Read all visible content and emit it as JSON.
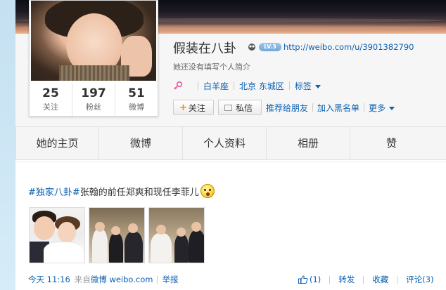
{
  "profile": {
    "name": "假装在八卦",
    "level_badge": "LV.3",
    "url": "http://weibo.com/u/3901382790",
    "bio": "她还没有填写个人简介",
    "meta": {
      "zodiac": "白羊座",
      "location": "北京 东城区",
      "tags_label": "标签"
    },
    "actions": {
      "follow": "关注",
      "message": "私信",
      "recommend": "推荐给朋友",
      "blacklist": "加入黑名单",
      "more": "更多"
    },
    "stats": [
      {
        "value": "25",
        "label": "关注"
      },
      {
        "value": "197",
        "label": "粉丝"
      },
      {
        "value": "51",
        "label": "微博"
      }
    ]
  },
  "nav": {
    "tabs": [
      "她的主页",
      "微博",
      "个人资料",
      "相册",
      "赞"
    ]
  },
  "post": {
    "hashtag": "#独家八卦#",
    "text": "张翰的前任郑爽和现任李菲儿",
    "time": "今天 11:16",
    "source_prefix": "来自",
    "source": "微博 weibo.com",
    "report": "举报",
    "like": "(1)",
    "forward": "转发",
    "favorite": "收藏",
    "comment": "评论(3)"
  },
  "colors": {
    "link": "#0a61b3",
    "follow_plus": "#ff8a00",
    "background": "#f6f6f6"
  }
}
